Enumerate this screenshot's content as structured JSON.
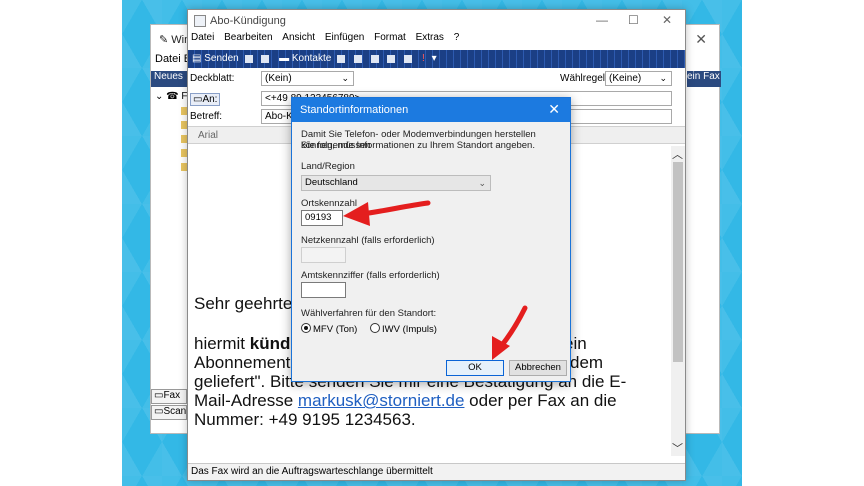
{
  "back_window": {
    "title": "Win",
    "menu": "Datei  B",
    "nav_head": "Neues",
    "tree_root": "Fa",
    "right_bar": "ein Fax e",
    "tabs": [
      "Fax",
      "Scan"
    ]
  },
  "main_window": {
    "title": "Abo-Kündigung",
    "menu": [
      "Datei",
      "Bearbeiten",
      "Ansicht",
      "Einfügen",
      "Format",
      "Extras",
      "?"
    ],
    "toolbar": {
      "send": "Senden",
      "contacts": "Kontakte"
    },
    "header": {
      "cover_label": "Deckblatt:",
      "cover_value": "(Kein)",
      "dial_rule_label": "Wählregel:",
      "dial_rule_value": "(Keine)",
      "to_label": "An:",
      "to_value": "<+49 89 123456789>",
      "subject_label": "Betreff:",
      "subject_value": "Abo-Kü"
    },
    "font": "Arial",
    "body": {
      "greeting": "Sehr geehrte",
      "line1_a": "hiermit ",
      "line1_b": "künd",
      "line1_c": "ein",
      "line2_a": "Abonnement",
      "line2_b": "dem",
      "line3": "geliefert\". Bitte senden Sie mir eine Bestätigung an die E-",
      "line4_a": "Mail-Adresse ",
      "line4_link": "markusk@storniert.de",
      "line4_b": " oder per Fax an die",
      "line5": "Nummer: +49 9195 1234563."
    },
    "status": "Das Fax wird an die Auftragswarteschlange übermittelt"
  },
  "dialog": {
    "title": "Standortinformationen",
    "intro_line1": "Damit Sie Telefon- oder Modemverbindungen herstellen können, müssen",
    "intro_line2": "Sie folgende Informationen zu Ihrem Standort angeben.",
    "region_label": "Land/Region",
    "region_value": "Deutschland",
    "area_code_label": "Ortskennzahl",
    "area_code_value": "09193",
    "carrier_label": "Netzkennzahl (falls erforderlich)",
    "carrier_value": "",
    "outside_line_label": "Amtskennziffer (falls erforderlich)",
    "outside_line_value": "",
    "dial_method_label": "Wählverfahren für den Standort:",
    "dial_tone": "MFV (Ton)",
    "dial_pulse": "IWV (Impuls)",
    "ok": "OK",
    "cancel": "Abbrechen"
  },
  "colors": {
    "dialog_titlebar": "#1c7ae0",
    "toolbar": "#1b3f85",
    "arrow": "#e41e1e",
    "link": "#1f5fc1",
    "desktop": "#33b8e6"
  }
}
